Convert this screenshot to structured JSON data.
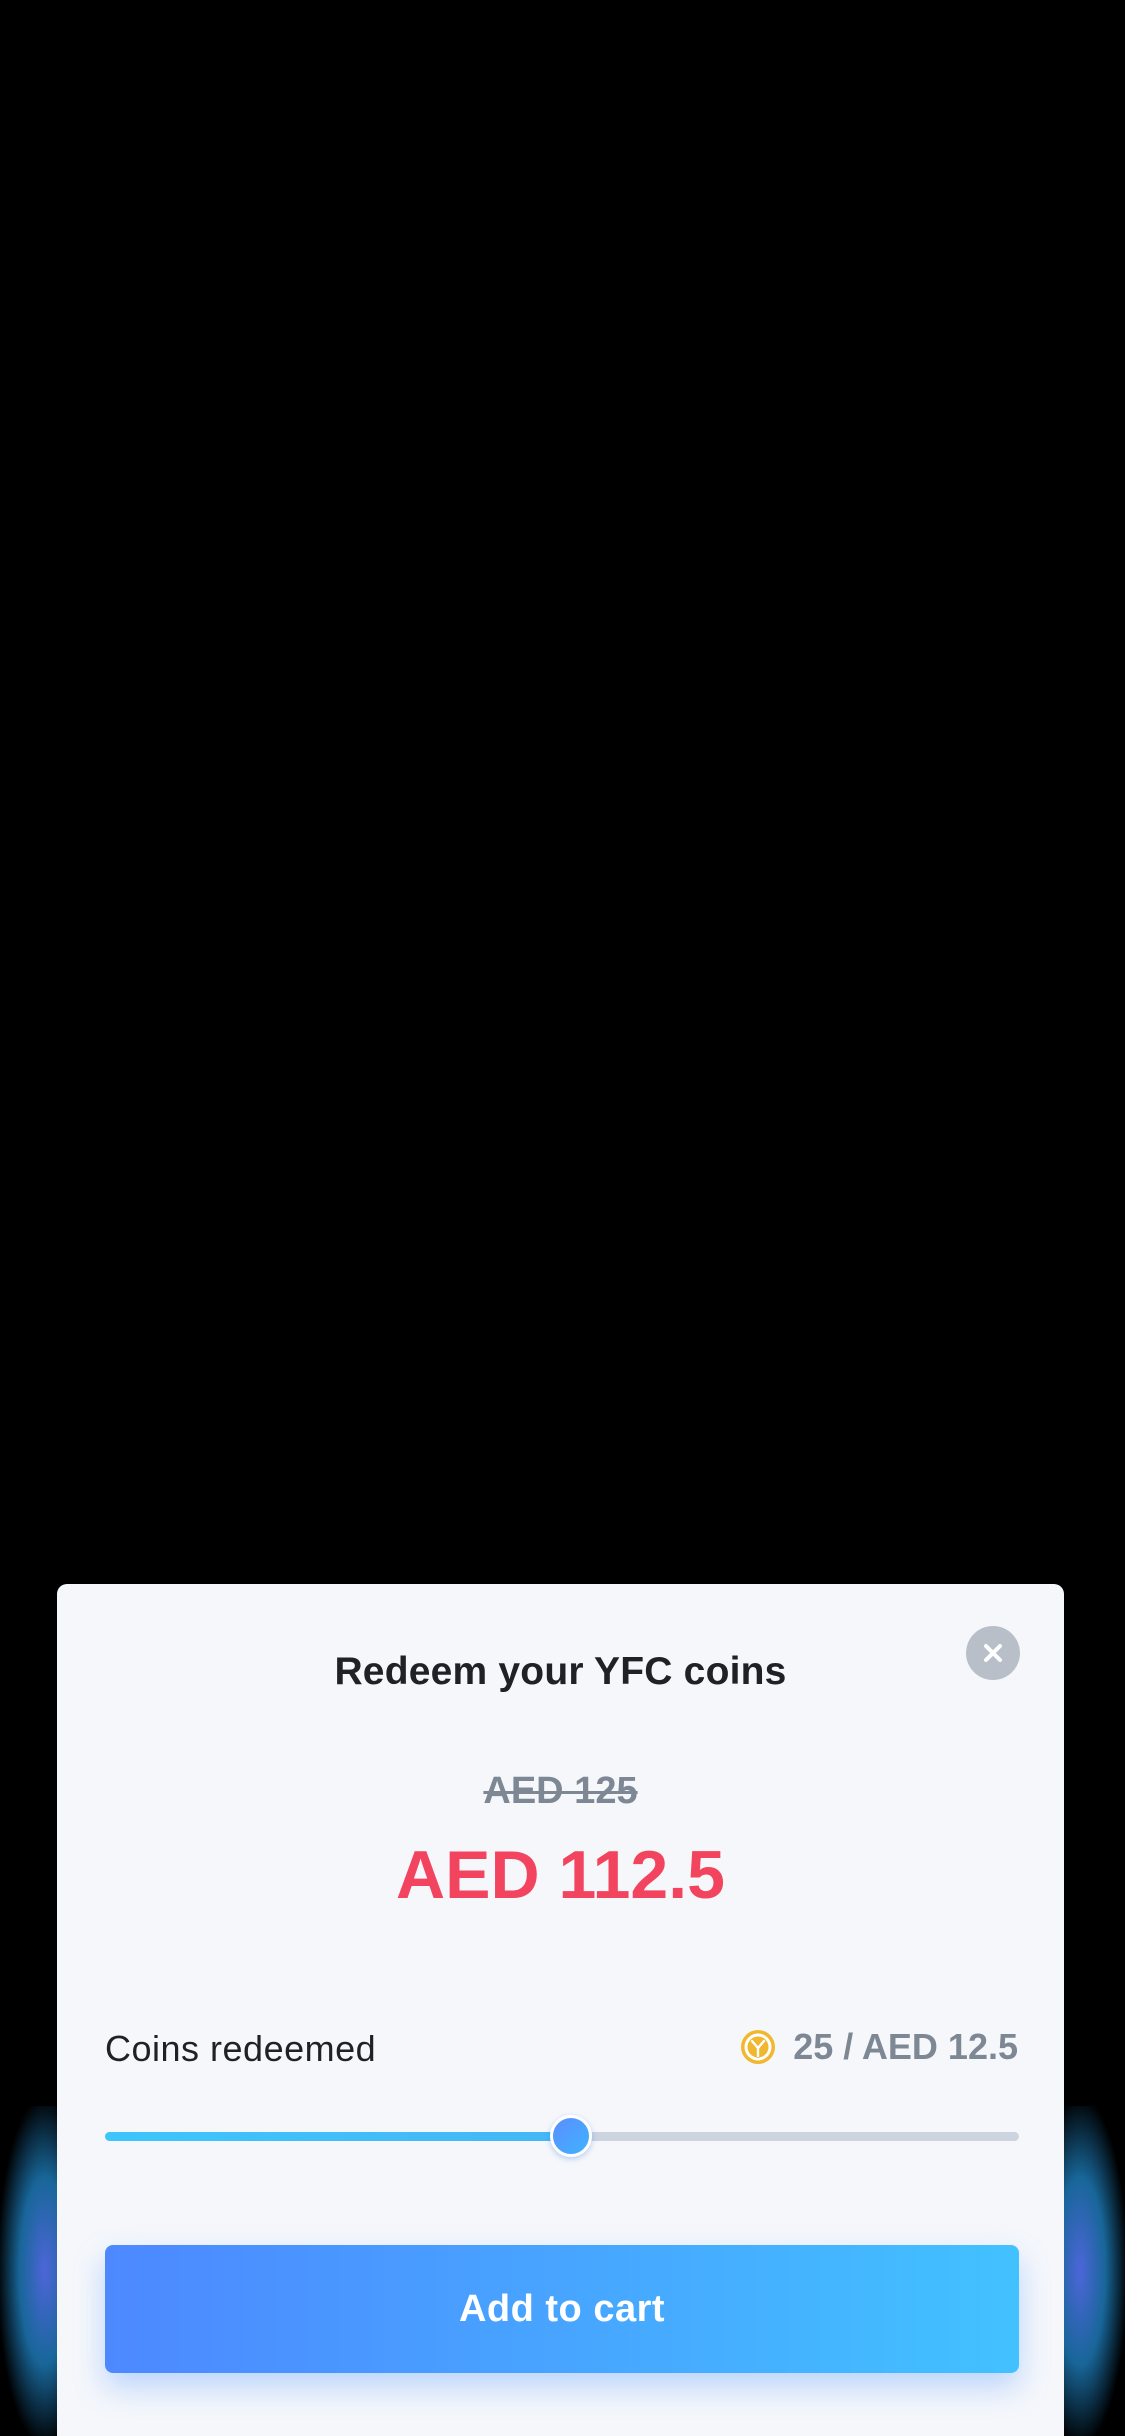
{
  "modal": {
    "title": "Redeem your YFC coins",
    "close_icon": "close-icon",
    "original_price": "AED 125",
    "discounted_price": "AED 112.5",
    "coins": {
      "label": "Coins redeemed",
      "icon": "coin-icon",
      "value_text": "25 / AED 12.5"
    },
    "slider": {
      "level_fraction": 0.51
    },
    "add_to_cart_label": "Add to cart"
  },
  "colors": {
    "background": "#000000",
    "sheet": "#F5F7FB",
    "title": "#1E2126",
    "strike_price": "#7D8894",
    "price_accent": "#F2445E",
    "slider_fill": "#3EC5FB",
    "slider_track": "#CBD4DF",
    "button_gradient_start": "#4D88FF",
    "button_gradient_end": "#42C1FF",
    "coin": "#F0B72F"
  }
}
